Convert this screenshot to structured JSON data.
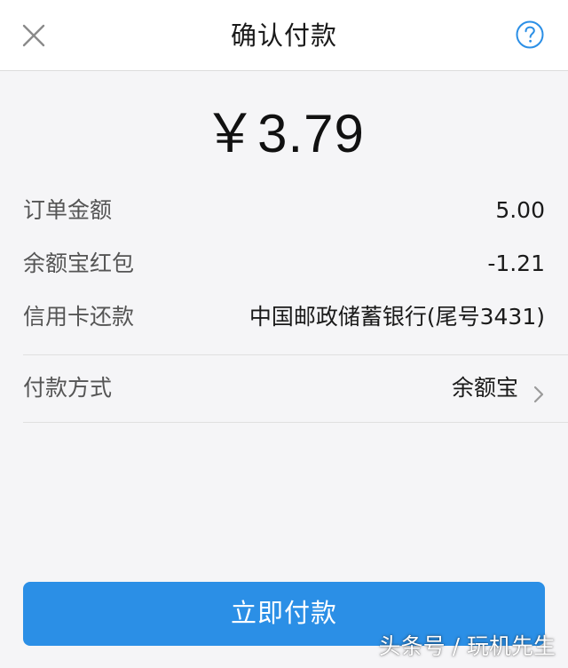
{
  "header": {
    "title": "确认付款",
    "close_icon": "close-icon",
    "help_icon": "help-circle-icon"
  },
  "payment": {
    "amount": "￥3.79",
    "rows": [
      {
        "label": "订单金额",
        "value": "5.00"
      },
      {
        "label": "余额宝红包",
        "value": "-1.21"
      },
      {
        "label": "信用卡还款",
        "value": "中国邮政储蓄银行(尾号3431)"
      }
    ],
    "method": {
      "label": "付款方式",
      "value": "余额宝"
    }
  },
  "actions": {
    "pay_label": "立即付款"
  },
  "watermark": "头条号 / 玩机先生",
  "colors": {
    "accent": "#2b8fe6",
    "background": "#f5f5f7",
    "header_bg": "#ffffff"
  }
}
